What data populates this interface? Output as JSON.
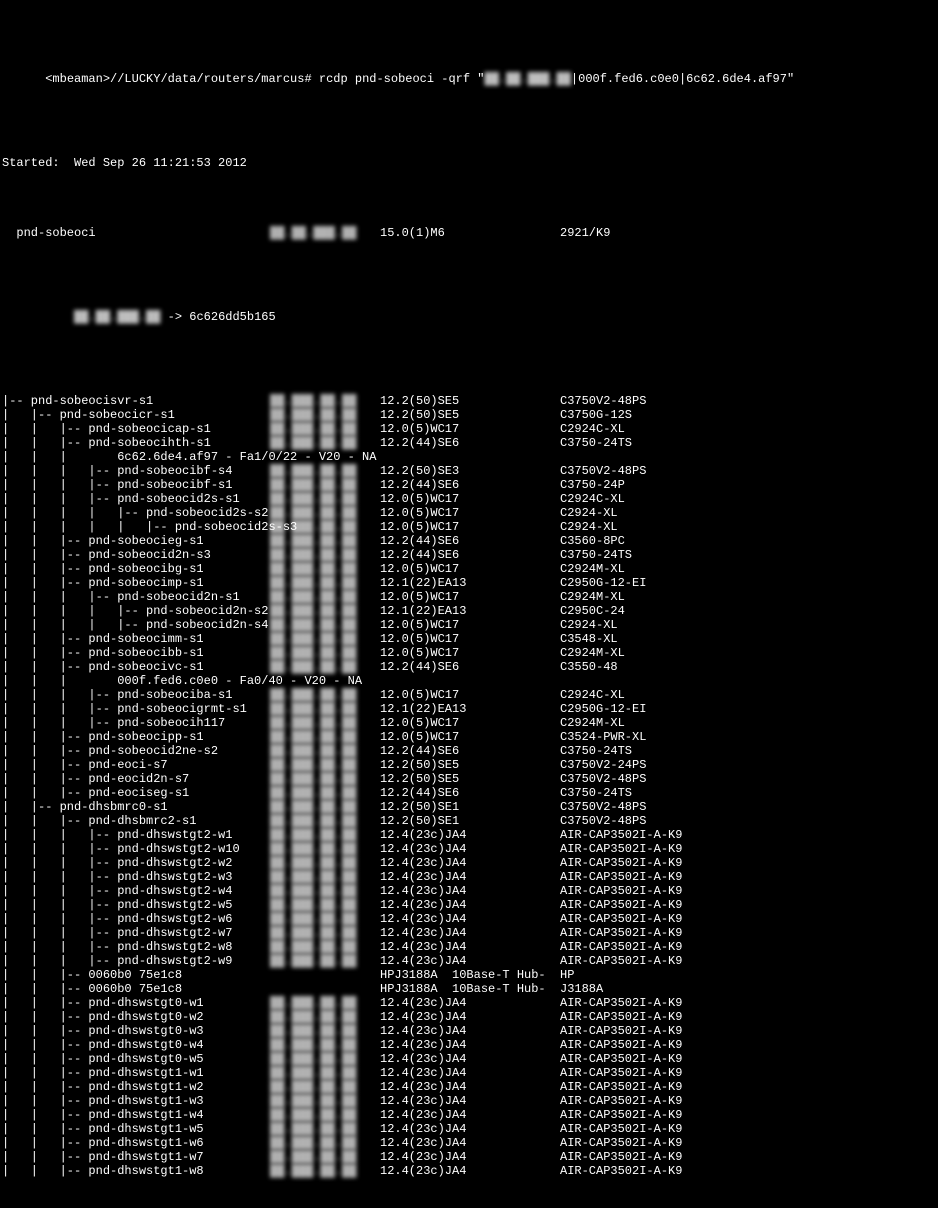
{
  "header": {
    "prompt": "<mbeaman>//LUCKY/data/routers/marcus# rcdp pnd-sobeoci -qrf \"",
    "prompt_ip_blur": "██.██.███.██",
    "prompt_tail": "|000f.fed6.c0e0|6c62.6de4.af97\"",
    "started": "Started:  Wed Sep 26 11:21:53 2012",
    "root_name": "  pnd-sobeoci",
    "root_ver": "15.0(1)M6",
    "root_mod": "2921/K9",
    "root_ip_line_pre": "    ",
    "root_ip_blur": "██.██.███.██",
    "root_ip_line_post": " -> 6c626dd5b165"
  },
  "rows": [
    {
      "d": 0,
      "h": "pnd-sobeocisvr-s1",
      "ip": "██.███.██.██",
      "v": "12.2(50)SE5",
      "m": "C3750V2-48PS"
    },
    {
      "d": 1,
      "h": "pnd-sobeocicr-s1",
      "ip": "██.███.██.██",
      "v": "12.2(50)SE5",
      "m": "C3750G-12S"
    },
    {
      "d": 2,
      "h": "pnd-sobeocicap-s1",
      "ip": "██.███.██.██",
      "v": "12.0(5)WC17",
      "m": "C2924C-XL"
    },
    {
      "d": 2,
      "h": "pnd-sobeocihth-s1",
      "ip": "██.███.██.██",
      "v": "12.2(44)SE6",
      "m": "C3750-24TS"
    },
    {
      "d": 3,
      "plain": "6c62.6de4.af97 - Fa1/0/22 - V20 - NA"
    },
    {
      "d": 3,
      "h": "pnd-sobeocibf-s4",
      "ip": "██.███.██.██",
      "v": "12.2(50)SE3",
      "m": "C3750V2-48PS"
    },
    {
      "d": 3,
      "h": "pnd-sobeocibf-s1",
      "ip": "██.███.██.██",
      "v": "12.2(44)SE6",
      "m": "C3750-24P"
    },
    {
      "d": 3,
      "h": "pnd-sobeocid2s-s1",
      "ip": "██.███.██.██",
      "v": "12.0(5)WC17",
      "m": "C2924C-XL"
    },
    {
      "d": 4,
      "h": "pnd-sobeocid2s-s2",
      "ip": "██.███.██.██",
      "v": "12.0(5)WC17",
      "m": "C2924-XL"
    },
    {
      "d": 5,
      "h": "pnd-sobeocid2s-s3",
      "ip": "██.███.██.██",
      "v": "12.0(5)WC17",
      "m": "C2924-XL"
    },
    {
      "d": 2,
      "h": "pnd-sobeocieg-s1",
      "ip": "██.███.██.██",
      "v": "12.2(44)SE6",
      "m": "C3560-8PC"
    },
    {
      "d": 2,
      "h": "pnd-sobeocid2n-s3",
      "ip": "██.███.██.██",
      "v": "12.2(44)SE6",
      "m": "C3750-24TS"
    },
    {
      "d": 2,
      "h": "pnd-sobeocibg-s1",
      "ip": "██.███.██.██",
      "v": "12.0(5)WC17",
      "m": "C2924M-XL"
    },
    {
      "d": 2,
      "h": "pnd-sobeocimp-s1",
      "ip": "██.███.██.██",
      "v": "12.1(22)EA13",
      "m": "C2950G-12-EI"
    },
    {
      "d": 3,
      "h": "pnd-sobeocid2n-s1",
      "ip": "██.███.██.██",
      "v": "12.0(5)WC17",
      "m": "C2924M-XL"
    },
    {
      "d": 4,
      "h": "pnd-sobeocid2n-s2",
      "ip": "██.███.██.██",
      "v": "12.1(22)EA13",
      "m": "C2950C-24"
    },
    {
      "d": 4,
      "h": "pnd-sobeocid2n-s4",
      "ip": "██.███.██.██",
      "v": "12.0(5)WC17",
      "m": "C2924-XL"
    },
    {
      "d": 2,
      "h": "pnd-sobeocimm-s1",
      "ip": "██.███.██.██",
      "v": "12.0(5)WC17",
      "m": "C3548-XL"
    },
    {
      "d": 2,
      "h": "pnd-sobeocibb-s1",
      "ip": "██.███.██.██",
      "v": "12.0(5)WC17",
      "m": "C2924M-XL"
    },
    {
      "d": 2,
      "h": "pnd-sobeocivc-s1",
      "ip": "██.███.██.██",
      "v": "12.2(44)SE6",
      "m": "C3550-48"
    },
    {
      "d": 3,
      "plain": "000f.fed6.c0e0 - Fa0/40 - V20 - NA"
    },
    {
      "d": 3,
      "h": "pnd-sobeociba-s1",
      "ip": "██.███.██.██",
      "v": "12.0(5)WC17",
      "m": "C2924C-XL"
    },
    {
      "d": 3,
      "h": "pnd-sobeocigrmt-s1",
      "ip": "██.███.██.██",
      "v": "12.1(22)EA13",
      "m": "C2950G-12-EI"
    },
    {
      "d": 3,
      "h": "pnd-sobeocih117",
      "ip": "██.███.██.██",
      "v": "12.0(5)WC17",
      "m": "C2924M-XL"
    },
    {
      "d": 2,
      "h": "pnd-sobeocipp-s1",
      "ip": "██.███.██.██",
      "v": "12.0(5)WC17",
      "m": "C3524-PWR-XL"
    },
    {
      "d": 2,
      "h": "pnd-sobeocid2ne-s2",
      "ip": "██.███.██.██",
      "v": "12.2(44)SE6",
      "m": "C3750-24TS"
    },
    {
      "d": 2,
      "h": "pnd-eoci-s7",
      "ip": "██.███.██.██",
      "v": "12.2(50)SE5",
      "m": "C3750V2-24PS"
    },
    {
      "d": 2,
      "h": "pnd-eocid2n-s7",
      "ip": "██.███.██.██",
      "v": "12.2(50)SE5",
      "m": "C3750V2-48PS"
    },
    {
      "d": 2,
      "h": "pnd-eociseg-s1",
      "ip": "██.███.██.██",
      "v": "12.2(44)SE6",
      "m": "C3750-24TS"
    },
    {
      "d": 1,
      "h": "pnd-dhsbmrc0-s1",
      "ip": "██.███.██.██",
      "v": "12.2(50)SE1",
      "m": "C3750V2-48PS"
    },
    {
      "d": 2,
      "h": "pnd-dhsbmrc2-s1",
      "ip": "██.███.██.██",
      "v": "12.2(50)SE1",
      "m": "C3750V2-48PS"
    },
    {
      "d": 3,
      "h": "pnd-dhswstgt2-w1",
      "ip": "██.███.██.██",
      "v": "12.4(23c)JA4",
      "m": "AIR-CAP3502I-A-K9"
    },
    {
      "d": 3,
      "h": "pnd-dhswstgt2-w10",
      "ip": "██.███.██.██",
      "v": "12.4(23c)JA4",
      "m": "AIR-CAP3502I-A-K9"
    },
    {
      "d": 3,
      "h": "pnd-dhswstgt2-w2",
      "ip": "██.███.██.██",
      "v": "12.4(23c)JA4",
      "m": "AIR-CAP3502I-A-K9"
    },
    {
      "d": 3,
      "h": "pnd-dhswstgt2-w3",
      "ip": "██.███.██.██",
      "v": "12.4(23c)JA4",
      "m": "AIR-CAP3502I-A-K9"
    },
    {
      "d": 3,
      "h": "pnd-dhswstgt2-w4",
      "ip": "██.███.██.██",
      "v": "12.4(23c)JA4",
      "m": "AIR-CAP3502I-A-K9"
    },
    {
      "d": 3,
      "h": "pnd-dhswstgt2-w5",
      "ip": "██.███.██.██",
      "v": "12.4(23c)JA4",
      "m": "AIR-CAP3502I-A-K9"
    },
    {
      "d": 3,
      "h": "pnd-dhswstgt2-w6",
      "ip": "██.███.██.██",
      "v": "12.4(23c)JA4",
      "m": "AIR-CAP3502I-A-K9"
    },
    {
      "d": 3,
      "h": "pnd-dhswstgt2-w7",
      "ip": "██.███.██.██",
      "v": "12.4(23c)JA4",
      "m": "AIR-CAP3502I-A-K9"
    },
    {
      "d": 3,
      "h": "pnd-dhswstgt2-w8",
      "ip": "██.███.██.██",
      "v": "12.4(23c)JA4",
      "m": "AIR-CAP3502I-A-K9"
    },
    {
      "d": 3,
      "h": "pnd-dhswstgt2-w9",
      "ip": "██.███.██.██",
      "v": "12.4(23c)JA4",
      "m": "AIR-CAP3502I-A-K9"
    },
    {
      "d": 2,
      "h": "0060b0 75e1c8",
      "ip": "",
      "v": "HPJ3188A  10Base-T Hub-",
      "m": "HP"
    },
    {
      "d": 2,
      "h": "0060b0 75e1c8",
      "ip": "",
      "v": "HPJ3188A  10Base-T Hub-",
      "m": "J3188A"
    },
    {
      "d": 2,
      "h": "pnd-dhswstgt0-w1",
      "ip": "██.███.██.██",
      "v": "12.4(23c)JA4",
      "m": "AIR-CAP3502I-A-K9"
    },
    {
      "d": 2,
      "h": "pnd-dhswstgt0-w2",
      "ip": "██.███.██.██",
      "v": "12.4(23c)JA4",
      "m": "AIR-CAP3502I-A-K9"
    },
    {
      "d": 2,
      "h": "pnd-dhswstgt0-w3",
      "ip": "██.███.██.██",
      "v": "12.4(23c)JA4",
      "m": "AIR-CAP3502I-A-K9"
    },
    {
      "d": 2,
      "h": "pnd-dhswstgt0-w4",
      "ip": "██.███.██.██",
      "v": "12.4(23c)JA4",
      "m": "AIR-CAP3502I-A-K9"
    },
    {
      "d": 2,
      "h": "pnd-dhswstgt0-w5",
      "ip": "██.███.██.██",
      "v": "12.4(23c)JA4",
      "m": "AIR-CAP3502I-A-K9"
    },
    {
      "d": 2,
      "h": "pnd-dhswstgt1-w1",
      "ip": "██.███.██.██",
      "v": "12.4(23c)JA4",
      "m": "AIR-CAP3502I-A-K9"
    },
    {
      "d": 2,
      "h": "pnd-dhswstgt1-w2",
      "ip": "██.███.██.██",
      "v": "12.4(23c)JA4",
      "m": "AIR-CAP3502I-A-K9"
    },
    {
      "d": 2,
      "h": "pnd-dhswstgt1-w3",
      "ip": "██.███.██.██",
      "v": "12.4(23c)JA4",
      "m": "AIR-CAP3502I-A-K9"
    },
    {
      "d": 2,
      "h": "pnd-dhswstgt1-w4",
      "ip": "██.███.██.██",
      "v": "12.4(23c)JA4",
      "m": "AIR-CAP3502I-A-K9"
    },
    {
      "d": 2,
      "h": "pnd-dhswstgt1-w5",
      "ip": "██.███.██.██",
      "v": "12.4(23c)JA4",
      "m": "AIR-CAP3502I-A-K9"
    },
    {
      "d": 2,
      "h": "pnd-dhswstgt1-w6",
      "ip": "██.███.██.██",
      "v": "12.4(23c)JA4",
      "m": "AIR-CAP3502I-A-K9"
    },
    {
      "d": 2,
      "h": "pnd-dhswstgt1-w7",
      "ip": "██.███.██.██",
      "v": "12.4(23c)JA4",
      "m": "AIR-CAP3502I-A-K9"
    },
    {
      "d": 2,
      "h": "pnd-dhswstgt1-w8",
      "ip": "██.███.██.██",
      "v": "12.4(23c)JA4",
      "m": "AIR-CAP3502I-A-K9"
    }
  ]
}
